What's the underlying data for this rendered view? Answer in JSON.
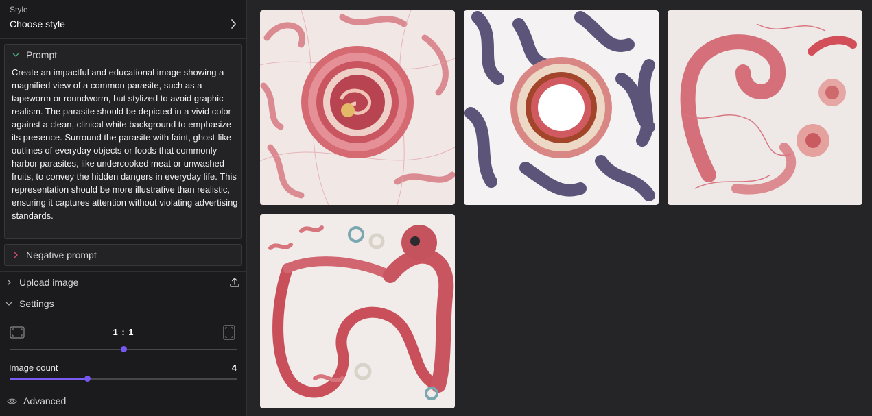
{
  "sidebar": {
    "style": {
      "label": "Style",
      "value": "Choose style"
    },
    "prompt": {
      "header": "Prompt",
      "text": "Create an impactful and educational image showing a magnified view of a common parasite, such as a tapeworm or roundworm, but stylized to avoid graphic realism. The parasite should be depicted in a vivid color against a clean, clinical white background to emphasize its presence. Surround the parasite with faint, ghost-like outlines of everyday objects or foods that commonly harbor parasites, like undercooked meat or unwashed fruits, to convey the hidden dangers in everyday life. This representation should be more illustrative than realistic, ensuring it captures attention without violating advertising standards."
    },
    "negative_prompt": {
      "header": "Negative prompt"
    },
    "upload": {
      "label": "Upload image"
    },
    "settings": {
      "header": "Settings",
      "aspect_ratio": {
        "value": "1 : 1",
        "slider_fraction": 0.5
      },
      "image_count": {
        "label": "Image count",
        "value": "4",
        "slider_fraction": 0.34
      }
    },
    "advanced": {
      "label": "Advanced"
    }
  },
  "icons": [
    "chevron-right-icon",
    "chevron-down-icon",
    "upload-icon",
    "landscape-ratio-icon",
    "portrait-ratio-icon",
    "eye-icon"
  ],
  "colors": {
    "accent": "#7657f2",
    "sidebar_bg": "#1b1b1d",
    "main_bg": "#252527"
  },
  "gallery": {
    "images": [
      {
        "subject": "worm-ring-cross-section"
      },
      {
        "subject": "purple-worms-ring"
      },
      {
        "subject": "pink-worm-parasites"
      },
      {
        "subject": "coiled-worm-creature"
      }
    ]
  }
}
